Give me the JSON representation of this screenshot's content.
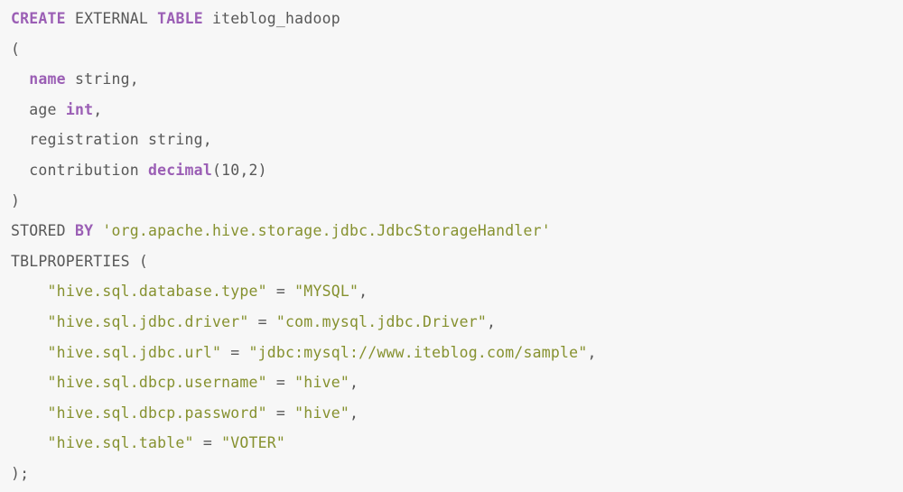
{
  "editor": {
    "language": "sql",
    "background_color": "#f7f7f7",
    "plain_color": "#585858",
    "keyword_color": "#9b5fb5",
    "string_color": "#86912f",
    "statement": "CREATE EXTERNAL TABLE iteblog_hadoop",
    "table_name": "iteblog_hadoop"
  },
  "lines": [
    {
      "id": "line-1",
      "tokens": [
        {
          "text": "CREATE",
          "kind": "keyword"
        },
        {
          "text": " ",
          "kind": "plain"
        },
        {
          "text": "EXTERNAL",
          "kind": "plain"
        },
        {
          "text": " ",
          "kind": "plain"
        },
        {
          "text": "TABLE",
          "kind": "keyword"
        },
        {
          "text": " iteblog_hadoop",
          "kind": "plain"
        }
      ]
    },
    {
      "id": "line-2",
      "tokens": [
        {
          "text": "(",
          "kind": "punct"
        }
      ]
    },
    {
      "id": "line-3",
      "tokens": [
        {
          "text": "  ",
          "kind": "plain"
        },
        {
          "text": "name",
          "kind": "keyword"
        },
        {
          "text": " string,",
          "kind": "plain"
        }
      ]
    },
    {
      "id": "line-4",
      "tokens": [
        {
          "text": "  age ",
          "kind": "plain"
        },
        {
          "text": "int",
          "kind": "type"
        },
        {
          "text": ",",
          "kind": "plain"
        }
      ]
    },
    {
      "id": "line-5",
      "tokens": [
        {
          "text": "  registration string,",
          "kind": "plain"
        }
      ]
    },
    {
      "id": "line-6",
      "tokens": [
        {
          "text": "  contribution ",
          "kind": "plain"
        },
        {
          "text": "decimal",
          "kind": "type"
        },
        {
          "text": "(10,2)",
          "kind": "number"
        }
      ]
    },
    {
      "id": "line-7",
      "tokens": [
        {
          "text": ")",
          "kind": "punct"
        }
      ]
    },
    {
      "id": "line-8",
      "tokens": [
        {
          "text": "STORED ",
          "kind": "plain"
        },
        {
          "text": "BY",
          "kind": "keyword"
        },
        {
          "text": " ",
          "kind": "plain"
        },
        {
          "text": "'org.apache.hive.storage.jdbc.JdbcStorageHandler'",
          "kind": "string"
        }
      ]
    },
    {
      "id": "line-9",
      "tokens": [
        {
          "text": "TBLPROPERTIES (",
          "kind": "plain"
        }
      ]
    },
    {
      "id": "line-10",
      "tokens": [
        {
          "text": "    ",
          "kind": "plain"
        },
        {
          "text": "\"hive.sql.database.type\"",
          "kind": "string"
        },
        {
          "text": " = ",
          "kind": "plain"
        },
        {
          "text": "\"MYSQL\"",
          "kind": "string"
        },
        {
          "text": ",",
          "kind": "plain"
        }
      ]
    },
    {
      "id": "line-11",
      "tokens": [
        {
          "text": "    ",
          "kind": "plain"
        },
        {
          "text": "\"hive.sql.jdbc.driver\"",
          "kind": "string"
        },
        {
          "text": " = ",
          "kind": "plain"
        },
        {
          "text": "\"com.mysql.jdbc.Driver\"",
          "kind": "string"
        },
        {
          "text": ",",
          "kind": "plain"
        }
      ]
    },
    {
      "id": "line-12",
      "tokens": [
        {
          "text": "    ",
          "kind": "plain"
        },
        {
          "text": "\"hive.sql.jdbc.url\"",
          "kind": "string"
        },
        {
          "text": " = ",
          "kind": "plain"
        },
        {
          "text": "\"jdbc:mysql://www.iteblog.com/sample\"",
          "kind": "string"
        },
        {
          "text": ",",
          "kind": "plain"
        }
      ]
    },
    {
      "id": "line-13",
      "tokens": [
        {
          "text": "    ",
          "kind": "plain"
        },
        {
          "text": "\"hive.sql.dbcp.username\"",
          "kind": "string"
        },
        {
          "text": " = ",
          "kind": "plain"
        },
        {
          "text": "\"hive\"",
          "kind": "string"
        },
        {
          "text": ",",
          "kind": "plain"
        }
      ]
    },
    {
      "id": "line-14",
      "tokens": [
        {
          "text": "    ",
          "kind": "plain"
        },
        {
          "text": "\"hive.sql.dbcp.password\"",
          "kind": "string"
        },
        {
          "text": " = ",
          "kind": "plain"
        },
        {
          "text": "\"hive\"",
          "kind": "string"
        },
        {
          "text": ",",
          "kind": "plain"
        }
      ]
    },
    {
      "id": "line-15",
      "tokens": [
        {
          "text": "    ",
          "kind": "plain"
        },
        {
          "text": "\"hive.sql.table\"",
          "kind": "string"
        },
        {
          "text": " = ",
          "kind": "plain"
        },
        {
          "text": "\"VOTER\"",
          "kind": "string"
        }
      ]
    },
    {
      "id": "line-16",
      "tokens": [
        {
          "text": ");",
          "kind": "punct"
        }
      ]
    }
  ]
}
